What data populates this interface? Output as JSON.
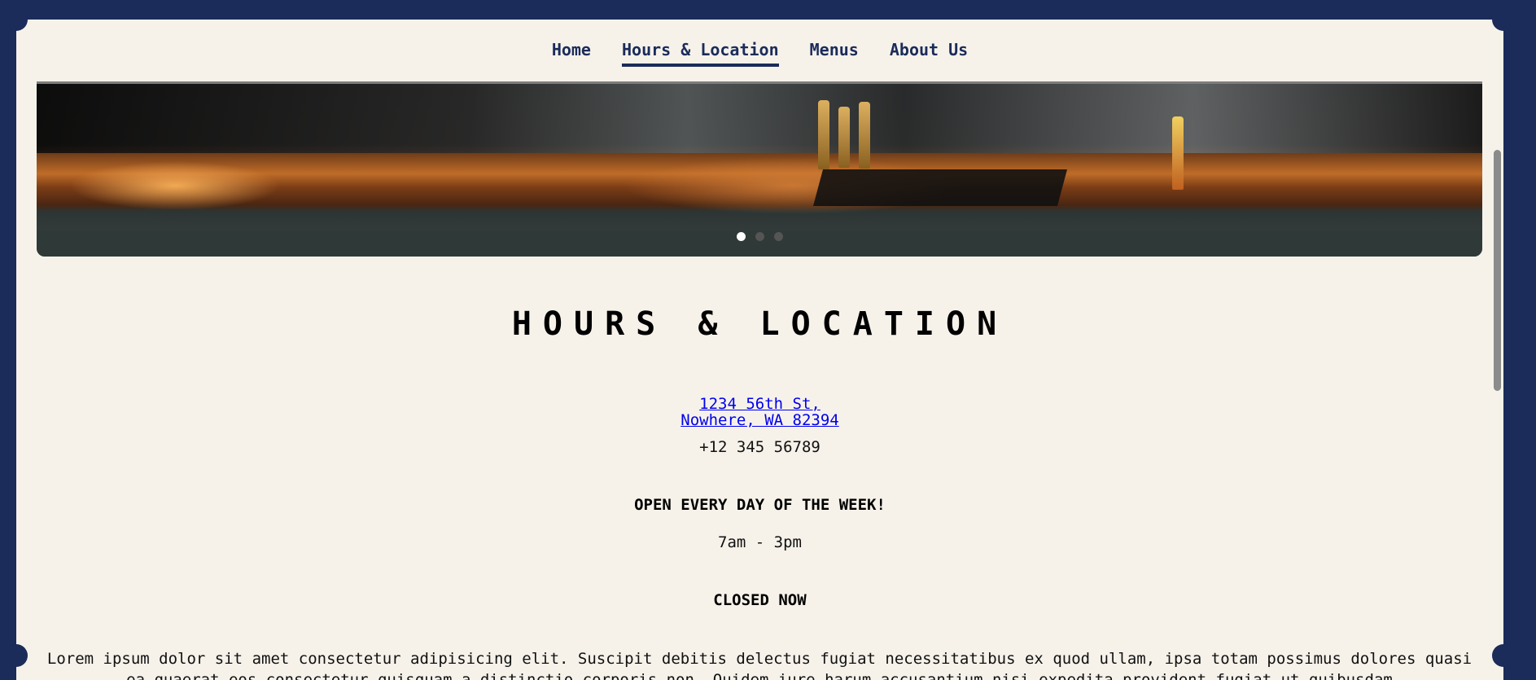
{
  "nav": {
    "items": [
      {
        "label": "Home"
      },
      {
        "label": "Hours & Location"
      },
      {
        "label": "Menus"
      },
      {
        "label": "About Us"
      }
    ]
  },
  "hero": {
    "image": "bar-counter-photo",
    "slides": 3,
    "active_slide": 1
  },
  "main": {
    "title": "HOURS & LOCATION",
    "address_line1": "1234 56th St,",
    "address_line2": "Nowhere, WA 82394",
    "phone": "+12 345 56789",
    "open_label": "OPEN EVERY DAY OF THE WEEK!",
    "hours": "7am - 3pm",
    "status": "CLOSED NOW",
    "description": "Lorem ipsum dolor sit amet consectetur adipisicing elit. Suscipit debitis delectus fugiat necessitatibus ex quod ullam, ipsa totam possimus dolores quasi ea quaerat eos consectetur quisquam a distinctio corporis non. Quidem iure harum accusantium nisi expedita provident fugiat ut quibusdam"
  },
  "colors": {
    "frame": "#1b2b5a",
    "page_bg": "#f6f2ea",
    "nav_text": "#1b2b5a",
    "link": "#0000ee"
  }
}
